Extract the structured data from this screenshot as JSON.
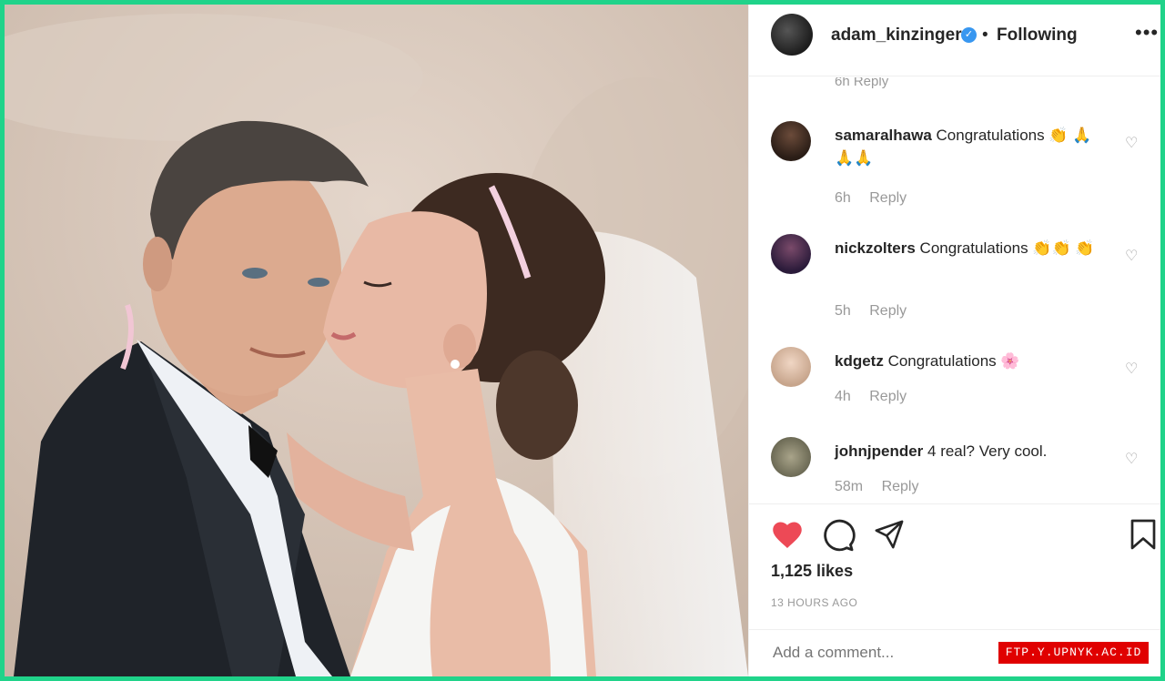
{
  "post": {
    "header": {
      "username": "adam_kinzinger",
      "separator": "•",
      "follow_status": "Following",
      "more_icon": "more-dots-icon"
    },
    "cut_comment_meta": "6h   Reply",
    "comments": [
      {
        "user": "samaralhawa",
        "text": "Congratulations",
        "emoji": "👏 🙏🙏🙏",
        "age": "6h",
        "reply": "Reply"
      },
      {
        "user": "nickzolters",
        "text": "Congratulations",
        "emoji": "👏👏 👏",
        "age": "5h",
        "reply": "Reply"
      },
      {
        "user": "kdgetz",
        "text": "Congratulations",
        "emoji": "🌸",
        "age": "4h",
        "reply": "Reply"
      },
      {
        "user": "johnjpender",
        "text": "4 real? Very cool.",
        "emoji": "",
        "age": "58m",
        "reply": "Reply"
      }
    ],
    "likes": "1,125 likes",
    "timestamp": "13 HOURS AGO",
    "comment_placeholder": "Add a comment..."
  },
  "colors": {
    "like_heart": "#ed4956",
    "verified": "#3897f0",
    "frame_border": "#20d38a"
  },
  "watermark": "FTP.Y.UPNYK.AC.ID"
}
